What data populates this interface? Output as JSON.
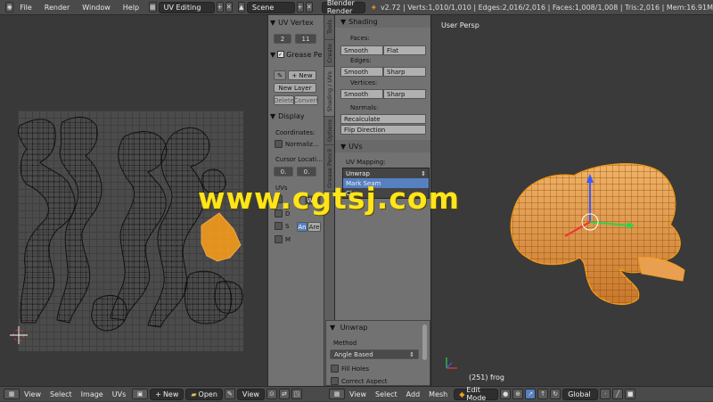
{
  "topbar": {
    "menus": [
      "File",
      "Render",
      "Window",
      "Help"
    ],
    "screen_layout": "UV Editing",
    "scene": "Scene",
    "engine": "Blender Render",
    "stats": "v2.72 | Verts:1,010/1,010 | Edges:2,016/2,016 | Faces:1,008/1,008 | Tris:2,016 | Mem:16.91M"
  },
  "tools_panel": {
    "uv_vertex_header": "UV Vertex",
    "value_a": "2",
    "value_b": "11",
    "grease_pencil_header": "Grease Pe",
    "new_label": "New",
    "new_layer_label": "New Layer",
    "delete_label": "Delete",
    "convert_label": "Convert",
    "display_header": "Display",
    "coordinates_label": "Coordinates:",
    "normalized_label": "Normaliz...",
    "cursor_location_label": "Cursor Locati...",
    "cursor_x": "0.",
    "cursor_y": "0.",
    "uvs_label": "UVs",
    "d_label": "D",
    "s_label": "S",
    "m_label": "M",
    "whi_label": "Whi",
    "an_label": "An",
    "are_label": "Are"
  },
  "tabs": [
    "Tools",
    "Create",
    "Shading / UVs",
    "Options",
    "Grease Pencil"
  ],
  "shading_panel": {
    "header": "Shading",
    "faces_label": "Faces:",
    "smooth_label": "Smooth",
    "flat_label": "Flat",
    "edges_label": "Edges:",
    "sharp_label": "Sharp",
    "vertices_label": "Vertices:",
    "normals_label": "Normals:",
    "recalculate_label": "Recalculate",
    "flip_direction_label": "Flip Direction"
  },
  "uvs_panel": {
    "header": "UVs",
    "uv_mapping_label": "UV Mapping:",
    "unwrap_selected": "Unwrap",
    "mark_seam_label": "Mark Seam",
    "clear_seam_label": "Cl..."
  },
  "unwrap_panel": {
    "header": "Unwrap",
    "method_label": "Method",
    "method_value": "Angle Based",
    "fill_holes_label": "Fill Holes",
    "correct_aspect_label": "Correct Aspect"
  },
  "viewport": {
    "view_label": "User Persp",
    "object_label": "(251) frog"
  },
  "uv_bottombar": {
    "menus": [
      "View",
      "Select",
      "Image",
      "UVs"
    ],
    "new_label": "New",
    "open_label": "Open",
    "view_label": "View"
  },
  "view3d_bottombar": {
    "menus": [
      "View",
      "Select",
      "Add",
      "Mesh"
    ],
    "mode": "Edit Mode",
    "orientation": "Global"
  },
  "watermark": "www.cgtsj.com",
  "colors": {
    "accent_orange": "#f29a1c",
    "selection_blue": "#5680c2",
    "watermark_yellow": "#ffe51a"
  }
}
